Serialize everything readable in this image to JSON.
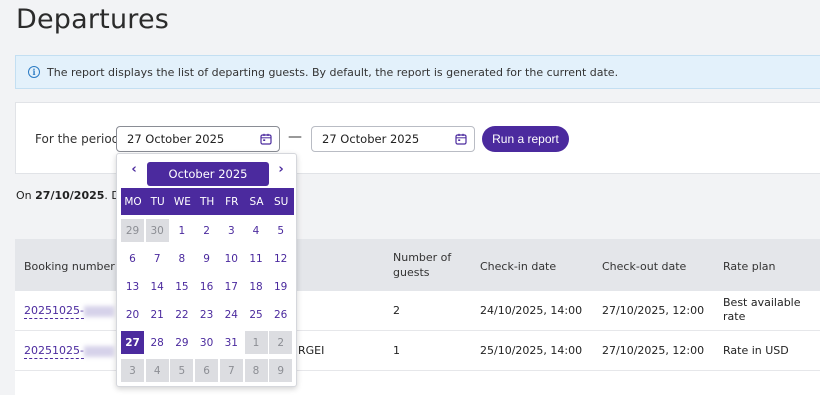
{
  "page": {
    "title": "Departures"
  },
  "info": {
    "text": "The report displays the list of departing guests. By default, the report is generated for the current date."
  },
  "filter": {
    "period_label": "For the period:",
    "date_from": "27 October 2025",
    "date_to": "27 October 2025",
    "separator": "—",
    "run_label": "Run a report"
  },
  "summary": {
    "date": "27/10/2025",
    "rest": ". Dep"
  },
  "calendar": {
    "prev": "‹",
    "next": "›",
    "month_label": "October 2025",
    "weekdays": [
      "MO",
      "TU",
      "WE",
      "TH",
      "FR",
      "SA",
      "SU"
    ],
    "weeks": [
      [
        {
          "d": "29",
          "o": true
        },
        {
          "d": "30",
          "o": true
        },
        {
          "d": "1"
        },
        {
          "d": "2"
        },
        {
          "d": "3"
        },
        {
          "d": "4"
        },
        {
          "d": "5"
        }
      ],
      [
        {
          "d": "6"
        },
        {
          "d": "7"
        },
        {
          "d": "8"
        },
        {
          "d": "9"
        },
        {
          "d": "10"
        },
        {
          "d": "11"
        },
        {
          "d": "12"
        }
      ],
      [
        {
          "d": "13"
        },
        {
          "d": "14"
        },
        {
          "d": "15"
        },
        {
          "d": "16"
        },
        {
          "d": "17"
        },
        {
          "d": "18"
        },
        {
          "d": "19"
        }
      ],
      [
        {
          "d": "20"
        },
        {
          "d": "21"
        },
        {
          "d": "22"
        },
        {
          "d": "23"
        },
        {
          "d": "24"
        },
        {
          "d": "25"
        },
        {
          "d": "26"
        }
      ],
      [
        {
          "d": "27",
          "s": true
        },
        {
          "d": "28"
        },
        {
          "d": "29"
        },
        {
          "d": "30"
        },
        {
          "d": "31"
        },
        {
          "d": "1",
          "o": true
        },
        {
          "d": "2",
          "o": true
        }
      ],
      [
        {
          "d": "3",
          "o": true
        },
        {
          "d": "4",
          "o": true
        },
        {
          "d": "5",
          "o": true
        },
        {
          "d": "6",
          "o": true
        },
        {
          "d": "7",
          "o": true
        },
        {
          "d": "8",
          "o": true
        },
        {
          "d": "9",
          "o": true
        }
      ]
    ],
    "selected_color": "#4b2a9e"
  },
  "table": {
    "headers": {
      "booking_number": "Booking number",
      "guests": "Number of guests",
      "checkin": "Check-in date",
      "checkout": "Check-out date",
      "rate_plan": "Rate plan"
    },
    "rows": [
      {
        "booking": "20251025-",
        "booking_tail": "",
        "guest_name": "",
        "guests": "2",
        "checkin": "24/10/2025, 14:00",
        "checkout": "27/10/2025, 12:00",
        "rate_plan": "Best available rate"
      },
      {
        "booking": "20251025-",
        "booking_tail": "",
        "guest_name": "RGEI",
        "guests": "1",
        "checkin": "25/10/2025, 14:00",
        "checkout": "27/10/2025, 12:00",
        "rate_plan": "Rate in USD"
      }
    ]
  },
  "colors": {
    "accent": "#4b2a9e",
    "info_bg": "#e3f1fb",
    "header_bg": "#e4e6ea"
  }
}
